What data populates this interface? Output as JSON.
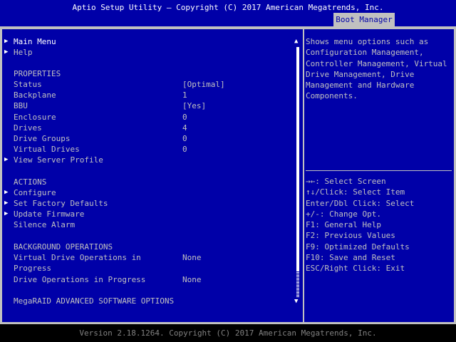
{
  "header": {
    "title": "Aptio Setup Utility – Copyright (C) 2017 American Megatrends, Inc.",
    "active_tab": "Boot Manager"
  },
  "main": {
    "main_menu": "Main Menu",
    "help": "Help",
    "properties_heading": "PROPERTIES",
    "properties": [
      {
        "label": "Status",
        "value": "[Optimal]"
      },
      {
        "label": "Backplane",
        "value": "1"
      },
      {
        "label": "BBU",
        "value": "[Yes]"
      },
      {
        "label": "Enclosure",
        "value": "0"
      },
      {
        "label": "Drives",
        "value": "4"
      },
      {
        "label": "Drive Groups",
        "value": "0"
      },
      {
        "label": "Virtual Drives",
        "value": "0"
      }
    ],
    "view_server_profile": "View Server Profile",
    "actions_heading": "ACTIONS",
    "actions": [
      "Configure",
      "Set Factory Defaults",
      "Update Firmware"
    ],
    "silence_alarm": "Silence Alarm",
    "background_heading": "BACKGROUND OPERATIONS",
    "background_ops": [
      {
        "label_line1": "Virtual Drive Operations in",
        "label_line2": "Progress",
        "value": "None"
      },
      {
        "label_line1": "Drive Operations in Progress",
        "value": "None"
      }
    ],
    "megaraid_heading": "MegaRAID ADVANCED SOFTWARE OPTIONS"
  },
  "help_panel": {
    "text": "Shows menu options such as\nConfiguration Management,\nController Management, Virtual\nDrive Management, Drive\nManagement and Hardware\nComponents.",
    "keys": [
      "→←: Select Screen",
      "↑↓/Click: Select Item",
      "Enter/Dbl Click: Select",
      "+/-: Change Opt.",
      "F1: General Help",
      "F2: Previous Values",
      "F9: Optimized Defaults",
      "F10: Save and Reset",
      "ESC/Right Click: Exit"
    ]
  },
  "footer": {
    "text": "Version 2.18.1264. Copyright (C) 2017 American Megatrends, Inc."
  },
  "icons": {
    "submenu_arrow": "▶",
    "scroll_up": "▲",
    "scroll_down": "▼"
  },
  "colors": {
    "panel_blue": "#0000a8",
    "frame_gray": "#c0c0c0",
    "highlight_white": "#ffffff"
  }
}
